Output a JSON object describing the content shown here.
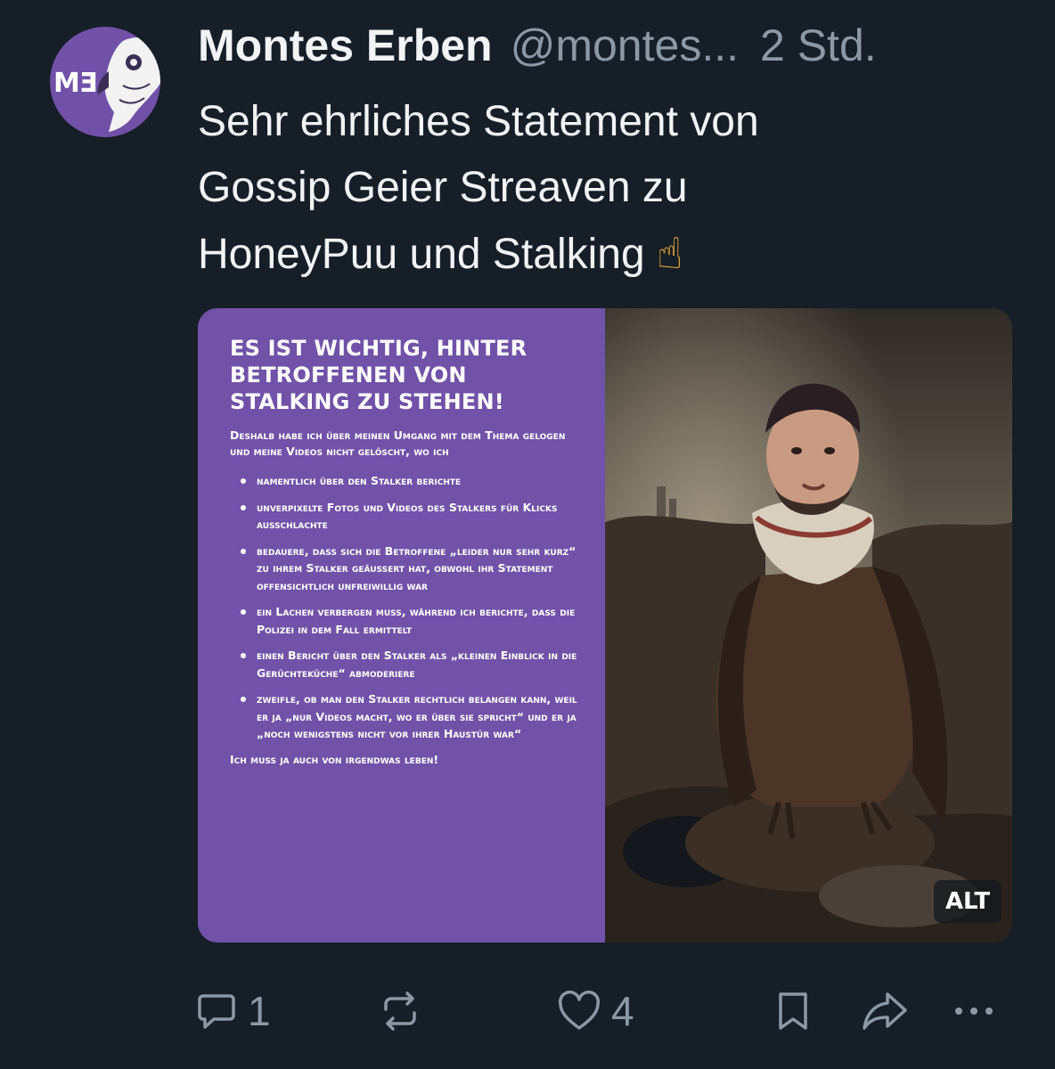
{
  "post": {
    "author_name": "Montes Erben",
    "handle": "@montes...",
    "time": "2 Std.",
    "avatar_mark": "MƎ",
    "text_lines": [
      "Sehr ehrliches Statement von",
      "Gossip Geier Streaven zu",
      "HoneyPuu und Stalking"
    ],
    "emoji": "☝"
  },
  "media": {
    "headline": "Es ist wichtig, hinter Betroffenen von Stalking zu stehen!",
    "intro": "Deshalb habe ich über meinen Umgang mit dem Thema gelogen und meine Videos nicht gelöscht, wo ich",
    "bullets": [
      "namentlich über den Stalker berichte",
      "unverpixelte Fotos und Videos des Stalkers für Klicks ausschlachte",
      "bedauere, dass sich die Betroffene „leider nur sehr kurz“ zu ihrem Stalker geäußert hat, obwohl ihr Statement offensichtlich unfreiwillig war",
      "ein Lachen verbergen muss, während ich berichte, dass die Polizei in dem Fall ermittelt",
      "einen Bericht über den Stalker als „kleinen Einblick in die Gerüchteküche“ abmoderiere",
      "zweifle, ob man den Stalker rechtlich belangen kann, weil er ja „nur Videos macht, wo er über sie spricht“ und er ja „noch wenigstens nicht vor ihrer Haustür war“"
    ],
    "outro": "Ich muss ja auch von irgendwas leben!",
    "alt_label": "ALT"
  },
  "actions": {
    "reply_count": "1",
    "like_count": "4",
    "icons": [
      "reply-icon",
      "repost-icon",
      "like-icon",
      "bookmark-icon",
      "share-icon",
      "more-icon"
    ]
  },
  "colors": {
    "background": "#161e27",
    "accent_purple": "#7152a8",
    "text_primary": "#f1f3f5",
    "text_secondary": "#8b98a5"
  }
}
